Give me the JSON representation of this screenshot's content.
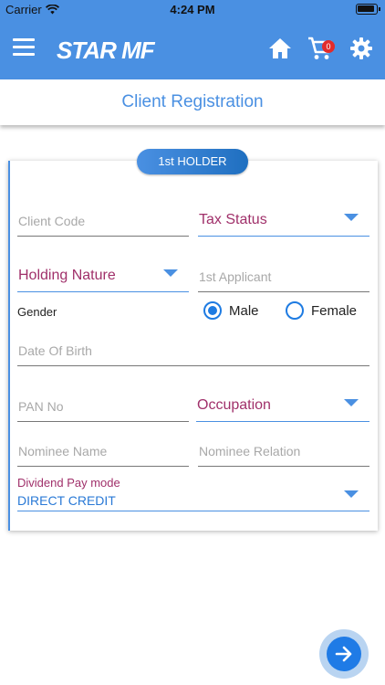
{
  "statusbar": {
    "carrier": "Carrier",
    "time": "4:24 PM"
  },
  "appbar": {
    "logo": "STAR MF",
    "cart_count": "0"
  },
  "page": {
    "title": "Client Registration"
  },
  "holder_tab": "1st HOLDER",
  "form": {
    "client_code_placeholder": "Client Code",
    "tax_status_label": "Tax Status",
    "holding_nature_label": "Holding Nature",
    "first_applicant_placeholder": "1st Applicant",
    "gender_label": "Gender",
    "gender_male": "Male",
    "gender_female": "Female",
    "gender_selected": "Male",
    "dob_placeholder": "Date Of Birth",
    "pan_placeholder": "PAN No",
    "occupation_label": "Occupation",
    "nominee_name_placeholder": "Nominee Name",
    "nominee_relation_placeholder": "Nominee Relation",
    "dividend_pay_mode_label": "Dividend Pay mode",
    "dividend_pay_mode_value": "DIRECT CREDIT"
  },
  "colors": {
    "primary": "#4a90e2",
    "select_text": "#a0306a",
    "badge": "#e22b2b",
    "fab": "#1f7be6"
  },
  "icons": [
    "wifi-icon",
    "battery-icon",
    "menu-icon",
    "home-icon",
    "cart-icon",
    "settings-icon",
    "arrow-right-icon"
  ]
}
